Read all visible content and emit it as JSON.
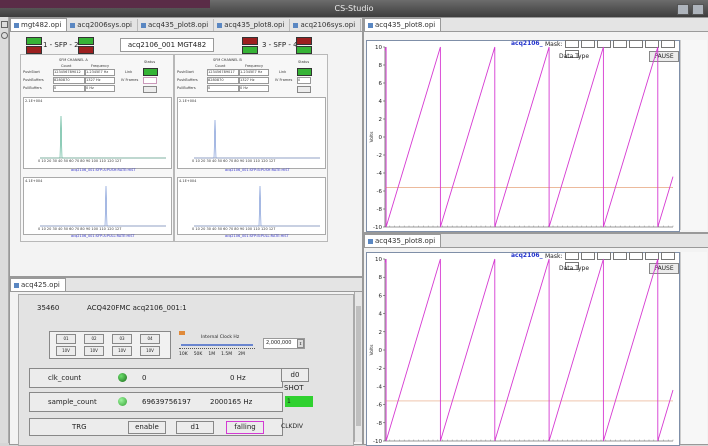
{
  "window": {
    "title": "CS-Studio"
  },
  "left_tabs": [
    {
      "label": "mgt482.opi",
      "active": true
    },
    {
      "label": "acq2006sys.opi",
      "active": false
    },
    {
      "label": "acq435_plot8.opi",
      "active": false
    },
    {
      "label": "acq435_plot8.opi",
      "active": false
    },
    {
      "label": "acq2106sys.opi",
      "active": false
    }
  ],
  "left_tab_overflow": "»₂",
  "right_tabs": {
    "top": "acq435_plot8.opi",
    "bottom": "acq435_plot8.opi"
  },
  "bottom_tab": "acq425.opi",
  "mgt": {
    "sfp_left": "1 - SFP - 2",
    "sfp_right": "3 - SFP - 4",
    "title": "acq2106_001 MGT482",
    "chan_a": {
      "name": "SFM CHANNEL A",
      "col_count": "Count",
      "col_freq": "Frequency",
      "link": "Link",
      "rows": [
        "PushStart",
        "PushBuffers",
        "PullBuffers"
      ],
      "vals": [
        [
          "123456789012",
          "1.2345E7 Hz"
        ],
        [
          "8280870",
          "1327 Hz"
        ],
        [
          "0",
          "0 Hz"
        ]
      ]
    },
    "chan_b": {
      "name": "SFM CHANNEL B",
      "col_count": "Count",
      "col_freq": "Frequency",
      "link": "Link",
      "rows": [
        "PushStart",
        "PushBuffers",
        "PullBuffers"
      ],
      "vals": [
        [
          "123456789017",
          "1.2345E7 Hz"
        ],
        [
          "8280870",
          "1327 Hz"
        ],
        [
          "0",
          "0 Hz"
        ]
      ]
    },
    "status": "Status",
    "ir_frames": "IV Frames",
    "ir_val": "0",
    "ticks": "0 10 20 30 40 50 60 70 80 90 100 110 120 127",
    "plot_captions": [
      "acq2106_001:SFP:A:PUSH:RATE:HIST",
      "acq2106_001:SFP:A:PULL:RATE:HIST",
      "acq2106_001:SFP:B:PUSH:RATE:HIST",
      "acq2106_001:SFP:B:PULL:RATE:HIST"
    ],
    "plot_ymax": [
      "2.1E+004",
      "4.1E+004",
      "2.1E+004",
      "4.1E+004"
    ]
  },
  "acq425": {
    "id": "35460",
    "name": "ACQ420FMC acq2106_001:1",
    "chans": [
      "01",
      "02",
      "03",
      "04"
    ],
    "ranges": [
      "10V",
      "10V",
      "10V",
      "10V"
    ],
    "clock_label": "Internal Clock Hz",
    "clock_value": "2,000,000",
    "clock_ticks": [
      "10K",
      "50K",
      "1M",
      "1.5M",
      "2M"
    ],
    "clk_count": {
      "label": "clk_count",
      "value": "0",
      "freq": "0 Hz"
    },
    "sample_count": {
      "label": "sample_count",
      "value": "69639756197",
      "freq": "2000165 Hz"
    },
    "d0": "d0",
    "shot": "SHOT",
    "shot_value": "1",
    "trg": "TRG",
    "enable": "enable",
    "d1": "d1",
    "falling": "falling",
    "clkdiv": "CLKDIV"
  },
  "colors": {
    "trace": "#d63ad2",
    "threshold": "#e6a37c",
    "led_green": "#36b336",
    "led_red": "#9c1f1f",
    "plot_title": "#2233cc"
  },
  "plot": {
    "title": "acq2106_",
    "mask_label": "Mask:",
    "data_type": "Data Type",
    "pause": "PAUSE",
    "ylabel": "Volts",
    "yticks": [
      "10",
      "8",
      "6",
      "4",
      "2",
      "0",
      "-2",
      "-4",
      "-6",
      "-8",
      "-10"
    ],
    "threshold": -5.6
  }
}
